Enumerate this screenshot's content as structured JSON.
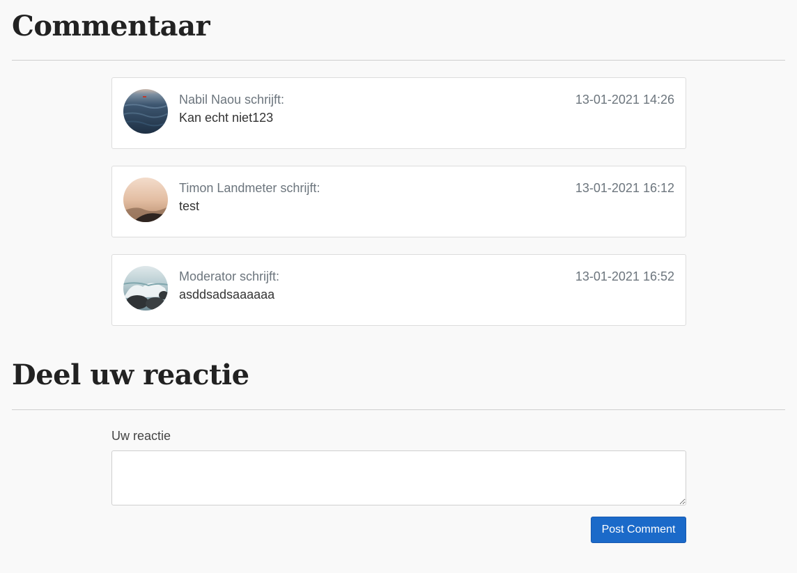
{
  "comments_section": {
    "title": "Commentaar"
  },
  "comments": [
    {
      "author": "Nabil Naou schrijft:",
      "timestamp": "13-01-2021 14:26",
      "body": "Kan echt niet123",
      "avatar": "sea-photo"
    },
    {
      "author": "Timon Landmeter schrijft:",
      "timestamp": "13-01-2021 16:12",
      "body": "test",
      "avatar": "misty-mountain-photo"
    },
    {
      "author": "Moderator schrijft:",
      "timestamp": "13-01-2021 16:52",
      "body": "asddsadsaaaaaa",
      "avatar": "wave-rocks-photo"
    }
  ],
  "reply_section": {
    "title": "Deel uw reactie",
    "label": "Uw reactie",
    "textarea_value": "",
    "button_label": "Post Comment"
  },
  "colors": {
    "accent": "#1b6ac9",
    "background": "#f9f9f9",
    "muted_text": "#6c757d"
  }
}
